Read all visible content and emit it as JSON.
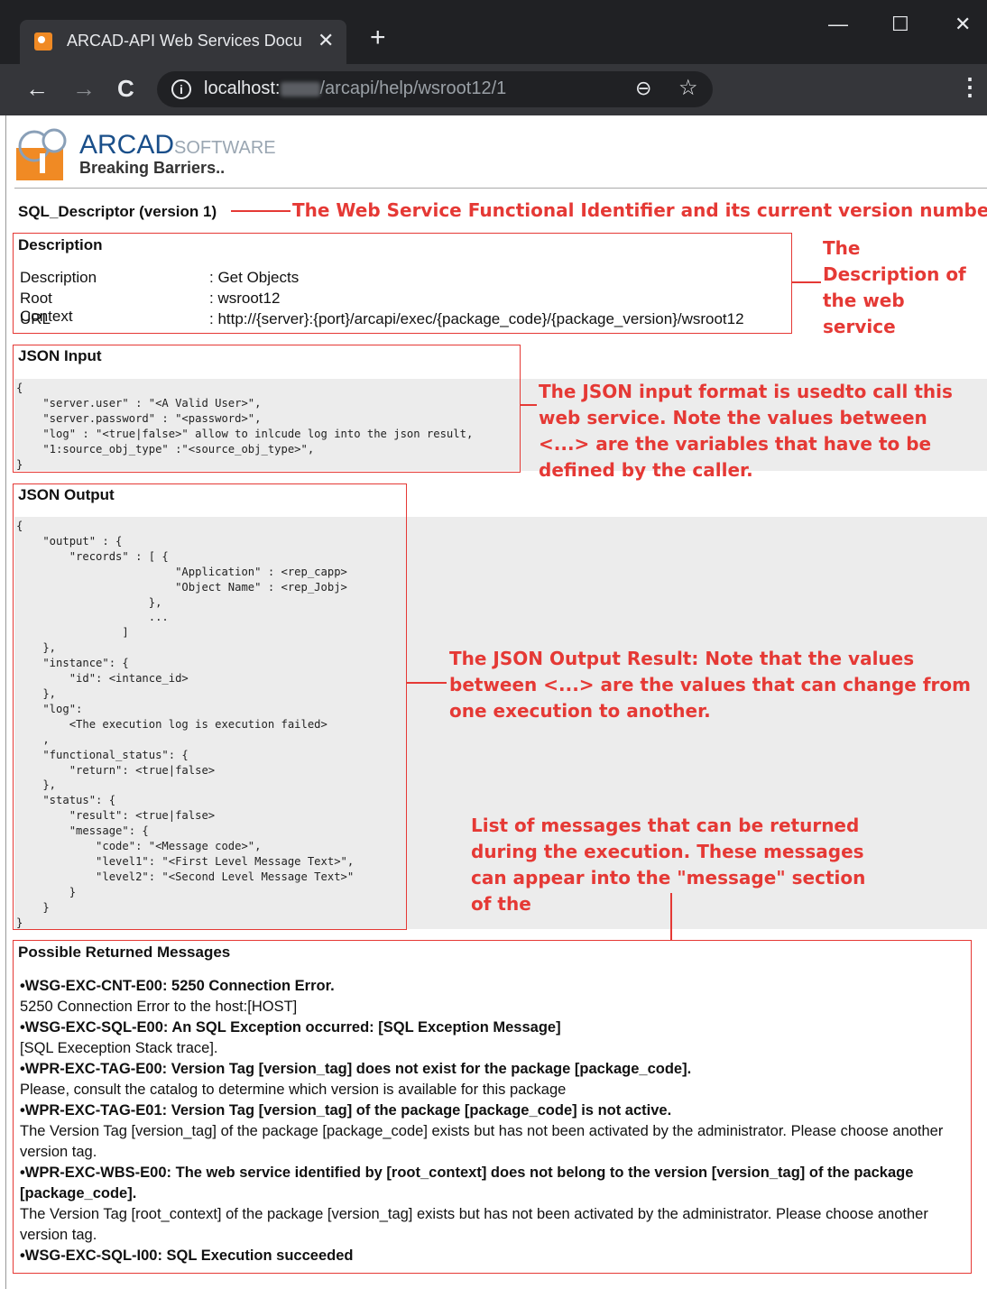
{
  "browser": {
    "tab_title": "ARCAD-API Web Services Docum",
    "tab_close": "✕",
    "new_tab": "+",
    "url_host": "localhost:",
    "url_path": "/arcapi/help/wsroot12/1",
    "win_min": "—",
    "win_max": "☐",
    "win_close": "✕",
    "back": "←",
    "forward": "→",
    "reload": "C",
    "info": "i",
    "zoom": "⊖",
    "star": "☆",
    "menu": "⋮"
  },
  "logo": {
    "word_main": "ARCAD",
    "word_soft": "SOFTWARE",
    "tagline": "Breaking Barriers.."
  },
  "service": {
    "title": "SQL_Descriptor (version 1)"
  },
  "description": {
    "heading": "Description",
    "rows": [
      {
        "key": "Description",
        "value": ": Get Objects"
      },
      {
        "key": "Root Context",
        "value": ": wsroot12"
      },
      {
        "key": "URL",
        "value": ": http://{server}:{port}/arcapi/exec/{package_code}/{package_version}/wsroot12"
      }
    ]
  },
  "json_input": {
    "heading": "JSON Input",
    "code": "{\n    \"server.user\" : \"<A Valid User>\",\n    \"server.password\" : \"<password>\",\n    \"log\" : \"<true|false>\" allow to inlcude log into the json result,\n    \"1:source_obj_type\" :\"<source_obj_type>\",\n}"
  },
  "json_output": {
    "heading": "JSON Output",
    "code": "{\n    \"output\" : {\n        \"records\" : [ {\n                        \"Application\" : <rep_capp>\n                        \"Object Name\" : <rep_Jobj>\n                    },\n                    ...\n                ]\n    },\n    \"instance\": {\n        \"id\": <intance_id>\n    },\n    \"log\":\n        <The execution log is execution failed>\n    ,\n    \"functional_status\": {\n        \"return\": <true|false>\n    },\n    \"status\": {\n        \"result\": <true|false>\n        \"message\": {\n            \"code\": \"<Message code>\",\n            \"level1\": \"<First Level Message Text>\",\n            \"level2\": \"<Second Level Message Text>\"\n        }\n    }\n}"
  },
  "messages": {
    "heading": "Possible Returned Messages",
    "items": [
      {
        "title": "•WSG-EXC-CNT-E00: 5250 Connection Error.",
        "detail": "5250 Connection Error to the host:[HOST]"
      },
      {
        "title": "•WSG-EXC-SQL-E00: An SQL Exception occurred: [SQL Exception Message]",
        "detail": "[SQL Exeception Stack trace]."
      },
      {
        "title": "•WPR-EXC-TAG-E00: Version Tag [version_tag] does not exist for the package [package_code].",
        "detail": "Please, consult the catalog to determine which version is available for this package"
      },
      {
        "title": "•WPR-EXC-TAG-E01: Version Tag [version_tag] of the package [package_code] is not active.",
        "detail": "The Version Tag [version_tag] of the package [package_code] exists but has not been activated by the administrator. Please choose another version tag."
      },
      {
        "title": "•WPR-EXC-WBS-E00: The web service identified by [root_context] does not belong to the version [version_tag] of the package [package_code].",
        "detail": "The Version Tag [root_context] of the package [version_tag] exists but has not been activated by the administrator. Please choose another version tag."
      },
      {
        "title": "•WSG-EXC-SQL-I00: SQL Execution succeeded",
        "detail": ""
      }
    ]
  },
  "annotations": {
    "title_note": "The Web Service Functional Identifier and its current version number",
    "desc_note": "The Description of the web service",
    "input_note": "The JSON input format is usedto call this web service. Note the values between <...> are the variables that have to be defined by the caller.",
    "output_note": "The JSON Output Result: Note that the values between <...> are the values that can change from one execution to another.",
    "messages_note": "List of messages that can be returned during the execution. These messages can appear into the \"message\" section of the",
    "color": "#e53935"
  }
}
